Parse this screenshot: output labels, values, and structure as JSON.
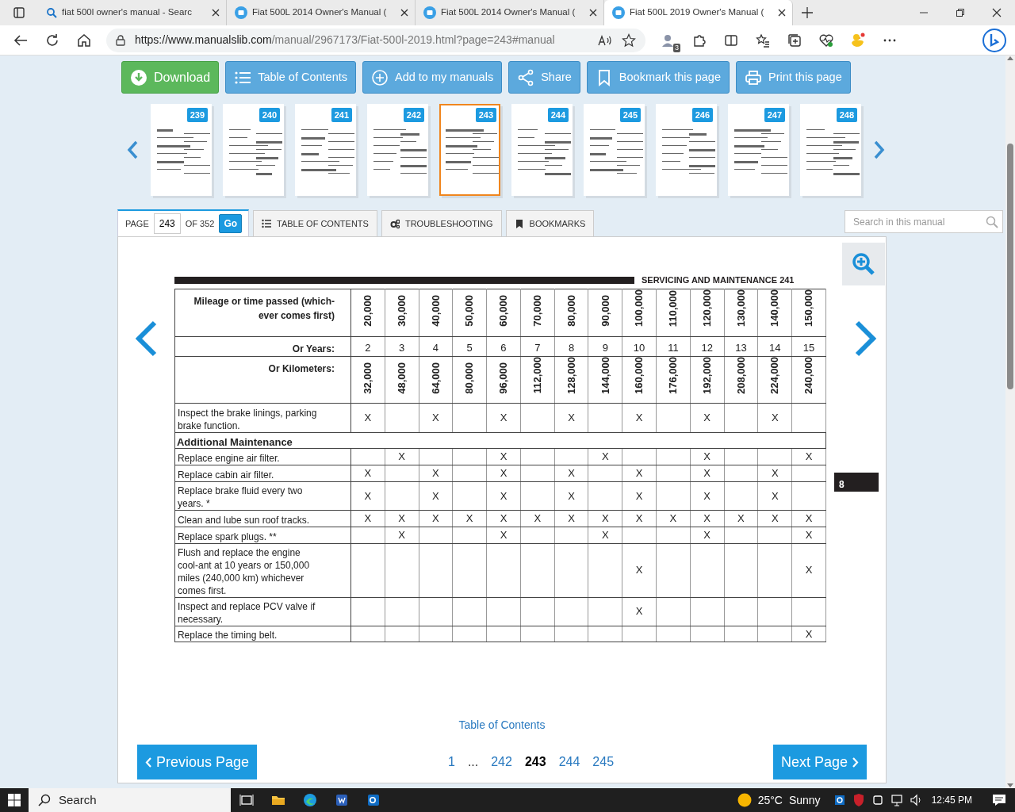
{
  "browser": {
    "tabs": [
      {
        "title": "fiat 500l owner's manual - Searc",
        "kind": "search",
        "selected": false
      },
      {
        "title": "Fiat 500L 2014 Owner's Manual (",
        "kind": "site",
        "selected": false
      },
      {
        "title": "Fiat 500L 2014 Owner's Manual (",
        "kind": "site",
        "selected": false
      },
      {
        "title": "Fiat 500L 2019 Owner's Manual (",
        "kind": "site",
        "selected": true
      }
    ],
    "url_host": "https://www.manualslib.com",
    "url_path": "/manual/2967173/Fiat-500l-2019.html?page=243#manual",
    "extension_badge": "3"
  },
  "toolbar": [
    {
      "label": "Download",
      "kind": "download"
    },
    {
      "label": "Table of Contents",
      "kind": "list"
    },
    {
      "label": "Add to my manuals",
      "kind": "add"
    },
    {
      "label": "Share",
      "kind": "share"
    },
    {
      "label": "Bookmark this page",
      "kind": "bookmark"
    },
    {
      "label": "Print this page",
      "kind": "print"
    }
  ],
  "thumbnails": [
    {
      "page": "239",
      "selected": false
    },
    {
      "page": "240",
      "selected": false
    },
    {
      "page": "241",
      "selected": false
    },
    {
      "page": "242",
      "selected": false
    },
    {
      "page": "243",
      "selected": true
    },
    {
      "page": "244",
      "selected": false
    },
    {
      "page": "245",
      "selected": false
    },
    {
      "page": "246",
      "selected": false
    },
    {
      "page": "247",
      "selected": false
    },
    {
      "page": "248",
      "selected": false
    }
  ],
  "page_box": {
    "label": "PAGE",
    "value": "243",
    "of": "OF 352",
    "go": "Go"
  },
  "doc_tabs": [
    {
      "label": "TABLE OF CONTENTS",
      "kind": "list"
    },
    {
      "label": "TROUBLESHOOTING",
      "kind": "gears"
    },
    {
      "label": "BOOKMARKS",
      "kind": "bookmark"
    }
  ],
  "search": {
    "placeholder": "Search in this manual"
  },
  "document": {
    "header": "SERVICING AND MAINTENANCE 241",
    "mileage_label": "Mileage or time passed (which-ever comes first)",
    "miles": [
      "20,000",
      "30,000",
      "40,000",
      "50,000",
      "60,000",
      "70,000",
      "80,000",
      "90,000",
      "100,000",
      "110,000",
      "120,000",
      "130,000",
      "140,000",
      "150,000"
    ],
    "years_label": "Or Years:",
    "years": [
      "2",
      "3",
      "4",
      "5",
      "6",
      "7",
      "8",
      "9",
      "10",
      "11",
      "12",
      "13",
      "14",
      "15"
    ],
    "km_label": "Or Kilometers:",
    "kilometers": [
      "32,000",
      "48,000",
      "64,000",
      "80,000",
      "96,000",
      "112,000",
      "128,000",
      "144,000",
      "160,000",
      "176,000",
      "192,000",
      "208,000",
      "224,000",
      "240,000"
    ],
    "rows": [
      {
        "kind": "item",
        "label": "Inspect the brake linings, parking brake function.",
        "cells": [
          "X",
          null,
          "X",
          null,
          "X",
          null,
          "X",
          null,
          "X",
          null,
          "X",
          null,
          "X",
          null
        ]
      },
      {
        "kind": "section",
        "label": "Additional Maintenance"
      },
      {
        "kind": "item",
        "label": "Replace engine air filter.",
        "cells": [
          null,
          "X",
          null,
          null,
          "X",
          null,
          null,
          "X",
          null,
          null,
          "X",
          null,
          null,
          "X"
        ]
      },
      {
        "kind": "item",
        "label": "Replace cabin air filter.",
        "cells": [
          "X",
          null,
          "X",
          null,
          "X",
          null,
          "X",
          null,
          "X",
          null,
          "X",
          null,
          "X",
          null
        ]
      },
      {
        "kind": "item",
        "label": "Replace brake fluid every two years. *",
        "cells": [
          "X",
          null,
          "X",
          null,
          "X",
          null,
          "X",
          null,
          "X",
          null,
          "X",
          null,
          "X",
          null
        ]
      },
      {
        "kind": "item",
        "label": "Clean and lube sun roof tracks.",
        "cells": [
          "X",
          "X",
          "X",
          "X",
          "X",
          "X",
          "X",
          "X",
          "X",
          "X",
          "X",
          "X",
          "X",
          "X"
        ]
      },
      {
        "kind": "item",
        "label": "Replace spark plugs. **",
        "cells": [
          null,
          "X",
          null,
          null,
          "X",
          null,
          null,
          "X",
          null,
          null,
          "X",
          null,
          null,
          "X"
        ]
      },
      {
        "kind": "item",
        "label": "Flush and replace the engine cool-ant at 10 years or 150,000 miles (240,000 km) whichever comes first.",
        "cells": [
          null,
          null,
          null,
          null,
          null,
          null,
          null,
          null,
          "X",
          null,
          null,
          null,
          null,
          "X"
        ]
      },
      {
        "kind": "item",
        "label": "Inspect and replace PCV valve if necessary.",
        "cells": [
          null,
          null,
          null,
          null,
          null,
          null,
          null,
          null,
          "X",
          null,
          null,
          null,
          null,
          null
        ]
      },
      {
        "kind": "item",
        "label": "Replace the timing belt.",
        "cells": [
          null,
          null,
          null,
          null,
          null,
          null,
          null,
          null,
          null,
          null,
          null,
          null,
          null,
          "X"
        ]
      }
    ],
    "side_tab": "8"
  },
  "footer": {
    "toc_link": "Table of Contents",
    "previous": "Previous Page",
    "next": "Next Page",
    "pages": [
      {
        "label": "1",
        "selected": false
      },
      {
        "label": "...",
        "kind": "gap"
      },
      {
        "label": "242",
        "selected": false
      },
      {
        "label": "243",
        "selected": true
      },
      {
        "label": "244",
        "selected": false
      },
      {
        "label": "245",
        "selected": false
      }
    ]
  },
  "taskbar": {
    "search": "Search",
    "temperature": "25°C",
    "weather": "Sunny",
    "time": "12:45 PM"
  }
}
